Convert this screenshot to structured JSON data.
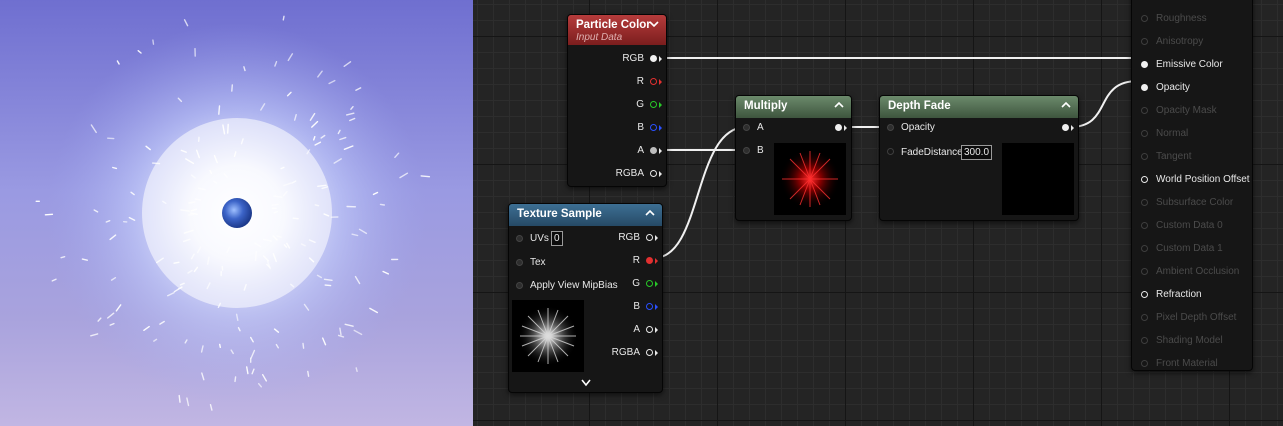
{
  "nodes": {
    "particle_color": {
      "title": "Particle Color",
      "subtitle": "Input Data",
      "pins": [
        "RGB",
        "R",
        "G",
        "B",
        "A",
        "RGBA"
      ]
    },
    "texture_sample": {
      "title": "Texture Sample",
      "inputs": [
        "UVs",
        "Tex",
        "Apply View MipBias"
      ],
      "uvs_value": "0",
      "outputs": [
        "RGB",
        "R",
        "G",
        "B",
        "A",
        "RGBA"
      ]
    },
    "multiply": {
      "title": "Multiply",
      "inputs": [
        "A",
        "B"
      ]
    },
    "depth_fade": {
      "title": "Depth Fade",
      "inputs": [
        "Opacity",
        "FadeDistance"
      ],
      "fade_distance_value": "300.0"
    },
    "material_result": {
      "pins": [
        "Roughness",
        "Anisotropy",
        "Emissive Color",
        "Opacity",
        "Opacity Mask",
        "Normal",
        "Tangent",
        "World Position Offset",
        "Subsurface Color",
        "Custom Data 0",
        "Custom Data 1",
        "Ambient Occlusion",
        "Refraction",
        "Pixel Depth Offset",
        "Shading Model",
        "Front Material"
      ],
      "active_pins": [
        "Emissive Color",
        "Opacity",
        "World Position Offset",
        "Refraction"
      ],
      "connected_pins": [
        "Emissive Color",
        "Opacity"
      ]
    }
  },
  "colors": {
    "header_particle_color": "#b63c3c",
    "header_texture_sample": "#3d6f93",
    "header_math": "#6b8a6b",
    "pin_red": "#e23030",
    "pin_green": "#28c828",
    "pin_blue": "#2a50ff",
    "wire": "#f0f0f0"
  },
  "icons": {
    "collapse": "chevron-up-icon",
    "dropdown": "chevron-down-icon",
    "expand": "chevron-down-icon"
  }
}
